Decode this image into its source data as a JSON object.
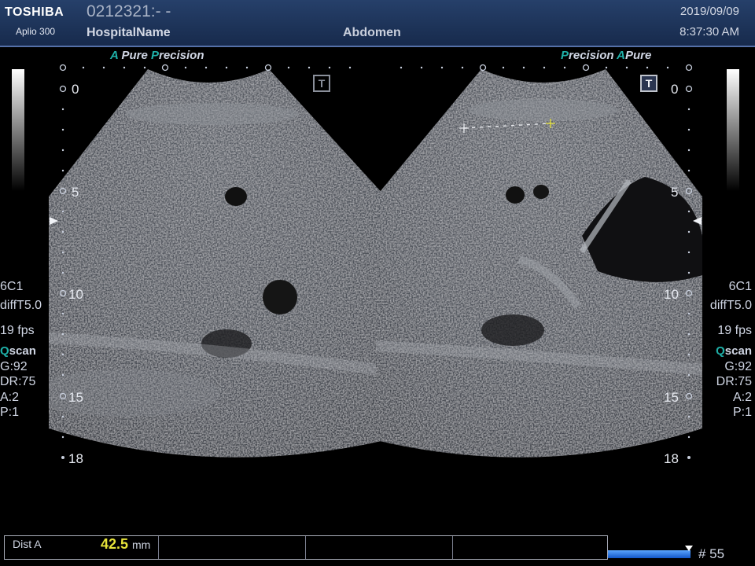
{
  "header": {
    "brand": "TOSHIBA",
    "model": "Aplio 300",
    "patient_id": "0212321:- -",
    "hospital": "HospitalName",
    "exam": "Abdomen",
    "date": "2019/09/09",
    "time": "8:37:30 AM"
  },
  "left_image": {
    "label_prefix": "A",
    "label_pure": " Pure ",
    "label_p": "P",
    "label_precision": "recision",
    "depth_ticks": [
      "0",
      "5",
      "10",
      "15",
      "18"
    ],
    "params": {
      "probe": "6C1",
      "mode": "diffT5.0",
      "fps": "19 fps",
      "q": "Q",
      "scan": "scan",
      "gain": "G:92",
      "dr": "DR:75",
      "a": "A:2",
      "p": "P:1"
    }
  },
  "right_image": {
    "label_p": "P",
    "label_precision": "recision ",
    "label_a": "A",
    "label_pure": "Pure",
    "depth_ticks": [
      "0",
      "5",
      "10",
      "15",
      "18"
    ],
    "params": {
      "probe": "6C1",
      "mode": "diffT5.0",
      "fps": "19 fps",
      "q": "Q",
      "scan": "scan",
      "gain": "G:92",
      "dr": "DR:75",
      "a": "A:2",
      "p": "P:1"
    }
  },
  "t_icon_label": "T",
  "measurement": {
    "label": "Dist A",
    "value": "42.5",
    "unit": "mm"
  },
  "cine": {
    "frame": "# 55",
    "progress": 1.0
  },
  "colors": {
    "accent": "#1fb0a8",
    "measure_value": "#e6e33a",
    "header_bg": "#1d3560"
  }
}
